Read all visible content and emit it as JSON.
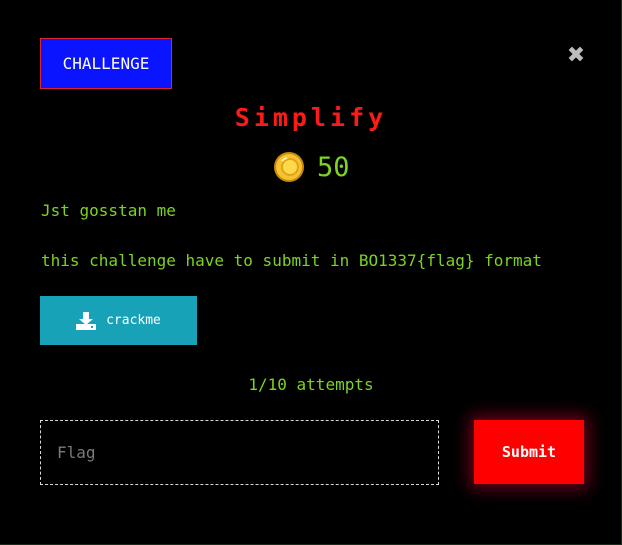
{
  "modal": {
    "tab_label": "CHALLENGE",
    "close_glyph": "✖",
    "title": "Simplify",
    "points": "50",
    "description_lines": [
      "Jst gosstan me",
      "this challenge have to submit in BO1337{flag} format"
    ],
    "download": {
      "label": "crackme",
      "icon": "download-icon"
    },
    "attempts": "1/10 attempts",
    "flag_input": {
      "placeholder": "Flag",
      "value": ""
    },
    "submit_label": "Submit"
  },
  "colors": {
    "background": "#000000",
    "tab_bg": "#0a14ff",
    "tab_border": "#e0222a",
    "title": "#ff1a1a",
    "text_green": "#7dd321",
    "download_bg": "#17a2b8",
    "submit_bg": "#ff0000",
    "close": "#bdbdbd"
  }
}
